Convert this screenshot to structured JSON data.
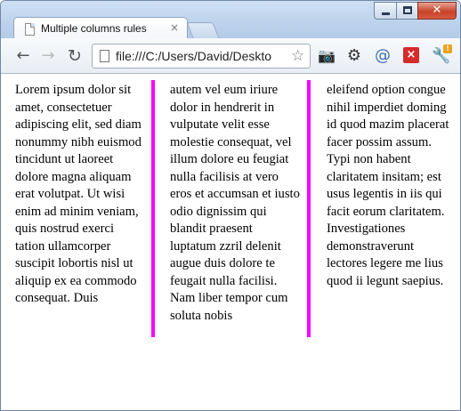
{
  "window": {
    "tab_title": "Multiple columns rules",
    "tab_close": "×"
  },
  "toolbar": {
    "back": "←",
    "forward": "→",
    "reload": "↻",
    "url": "file:///C:/Users/David/Deskto",
    "star": "☆"
  },
  "extensions": {
    "x_label": "×",
    "badge": "!"
  },
  "content": {
    "column_rule_color": "#ff00ff",
    "columns": [
      "Lorem ipsum dolor sit amet, consectetuer adipiscing elit, sed diam nonummy nibh euismod tincidunt ut laoreet dolore magna aliquam erat volutpat. Ut wisi enim ad minim veniam, quis nostrud exerci tation ullamcorper suscipit lobortis nisl ut aliquip ex ea commodo consequat. Duis",
      "autem vel eum iriure dolor in hendrerit in vulputate velit esse molestie consequat, vel illum dolore eu feugiat nulla facilisis at vero eros et accumsan et iusto odio dignissim qui blandit praesent luptatum zzril delenit augue duis dolore te feugait nulla facilisi. Nam liber tempor cum soluta nobis",
      "eleifend option congue nihil imperdiet doming id quod mazim placerat facer possim assum. Typi non habent claritatem insitam; est usus legentis in iis qui facit eorum claritatem. Investigationes demonstraverunt lectores legere me lius quod ii legunt saepius."
    ]
  }
}
